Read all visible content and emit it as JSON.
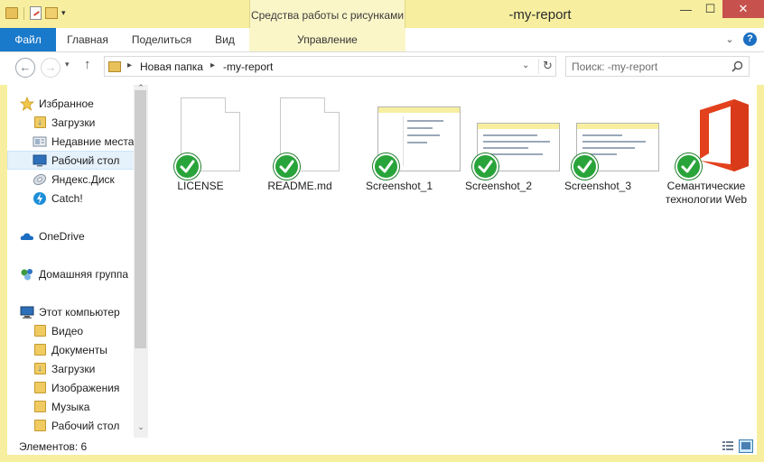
{
  "window": {
    "title": "-my-report",
    "context_tab_title": "Средства работы с рисунками",
    "frame_color": "#f7ef9f",
    "accent": "#1979ca"
  },
  "ribbon": {
    "tabs": [
      {
        "label": "Файл"
      },
      {
        "label": "Главная"
      },
      {
        "label": "Поделиться"
      },
      {
        "label": "Вид"
      },
      {
        "label": "Управление"
      }
    ]
  },
  "address": {
    "crumbs": [
      "Новая папка",
      "-my-report"
    ],
    "search_placeholder": "Поиск: -my-report"
  },
  "nav": {
    "favorites": {
      "label": "Избранное",
      "items": [
        {
          "label": "Загрузки",
          "icon": "downloads-folder-icon"
        },
        {
          "label": "Недавние места",
          "icon": "recent-places-icon"
        },
        {
          "label": "Рабочий стол",
          "icon": "desktop-icon",
          "selected": true
        },
        {
          "label": "Яндекс.Диск",
          "icon": "yandex-disk-icon"
        },
        {
          "label": "Catch!",
          "icon": "catch-icon"
        }
      ]
    },
    "onedrive": {
      "label": "OneDrive"
    },
    "homegroup": {
      "label": "Домашняя группа"
    },
    "computer": {
      "label": "Этот компьютер",
      "items": [
        {
          "label": "Видео",
          "icon": "video-folder-icon"
        },
        {
          "label": "Документы",
          "icon": "documents-folder-icon"
        },
        {
          "label": "Загрузки",
          "icon": "downloads-folder-icon"
        },
        {
          "label": "Изображения",
          "icon": "pictures-folder-icon"
        },
        {
          "label": "Музыка",
          "icon": "music-folder-icon"
        },
        {
          "label": "Рабочий стол",
          "icon": "desktop-folder-icon"
        }
      ]
    }
  },
  "files": [
    {
      "name": "LICENSE",
      "kind": "document",
      "synced": true
    },
    {
      "name": "README.md",
      "kind": "document",
      "synced": true
    },
    {
      "name": "Screenshot_1",
      "kind": "image",
      "synced": true
    },
    {
      "name": "Screenshot_2",
      "kind": "image",
      "synced": true
    },
    {
      "name": "Screenshot_3",
      "kind": "image",
      "synced": true
    },
    {
      "name": "Семантические технологии Web",
      "kind": "office",
      "synced": true
    }
  ],
  "status": {
    "items_text": "Элементов: 6"
  }
}
